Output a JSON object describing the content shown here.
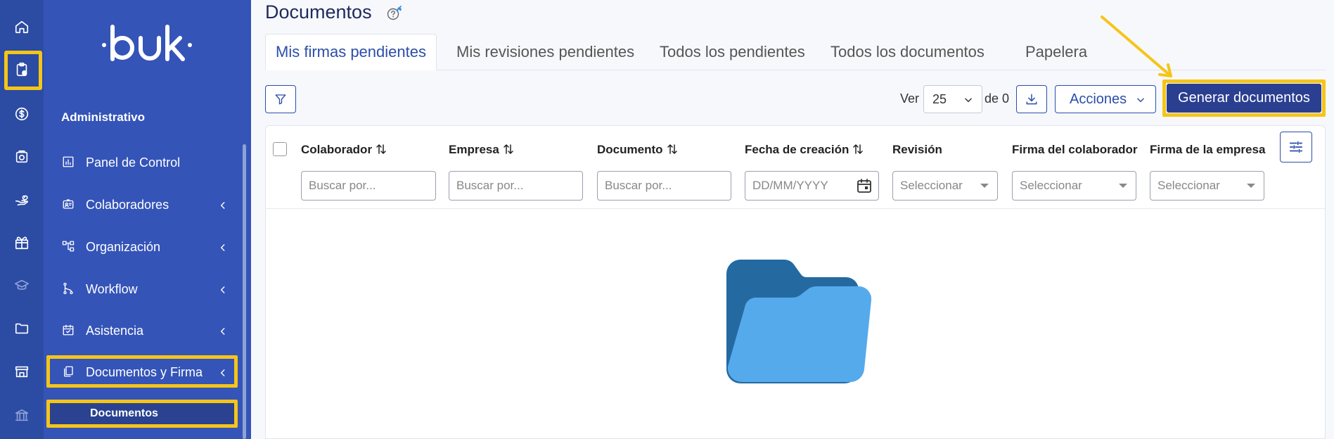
{
  "colors": {
    "rail_bg": "#2c4ba3",
    "sidebar_bg": "#3454b8",
    "accent": "#2b4ea8",
    "primary_button": "#2b3f91",
    "highlight": "#f5c518",
    "folder_dark": "#246aa1",
    "folder_light": "#55aaec"
  },
  "rail": {
    "icons": [
      "home-icon",
      "clipboard-icon",
      "dollar-icon",
      "camera-icon",
      "hand-heart-icon",
      "gift-icon",
      "graduation-cap-icon",
      "folder-icon",
      "store-icon",
      "bank-icon"
    ]
  },
  "sidebar": {
    "logo": "·buk·",
    "section": "Administrativo",
    "items": [
      {
        "label": "Panel de Control",
        "icon": "bar-chart-icon"
      },
      {
        "label": "Colaboradores",
        "icon": "id-card-icon"
      },
      {
        "label": "Organización",
        "icon": "org-chart-icon"
      },
      {
        "label": "Workflow",
        "icon": "workflow-icon"
      },
      {
        "label": "Asistencia",
        "icon": "calendar-check-icon"
      },
      {
        "label": "Documentos y Firma",
        "icon": "documents-icon"
      }
    ],
    "sub_item": "Documentos"
  },
  "header": {
    "title": "Documentos"
  },
  "tabs": [
    "Mis firmas pendientes",
    "Mis revisiones pendientes",
    "Todos los pendientes",
    "Todos los documentos",
    "Papelera"
  ],
  "toolbar": {
    "ver_label": "Ver",
    "page_size": "25",
    "de_label": "de 0",
    "acciones_label": "Acciones",
    "generate_label": "Generar documentos"
  },
  "table": {
    "columns": [
      {
        "label": "Colaborador",
        "sortable": true,
        "filter_placeholder": "Buscar por..."
      },
      {
        "label": "Empresa",
        "sortable": true,
        "filter_placeholder": "Buscar por..."
      },
      {
        "label": "Documento",
        "sortable": true,
        "filter_placeholder": "Buscar por..."
      },
      {
        "label": "Fecha de creación",
        "sortable": true,
        "filter_placeholder": "DD/MM/YYYY"
      },
      {
        "label": "Revisión",
        "sortable": false,
        "filter_placeholder": "Seleccionar"
      },
      {
        "label": "Firma del colaborador",
        "sortable": false,
        "filter_placeholder": "Seleccionar"
      },
      {
        "label": "Firma de la empresa",
        "sortable": false,
        "filter_placeholder": "Seleccionar"
      }
    ],
    "rows": []
  }
}
